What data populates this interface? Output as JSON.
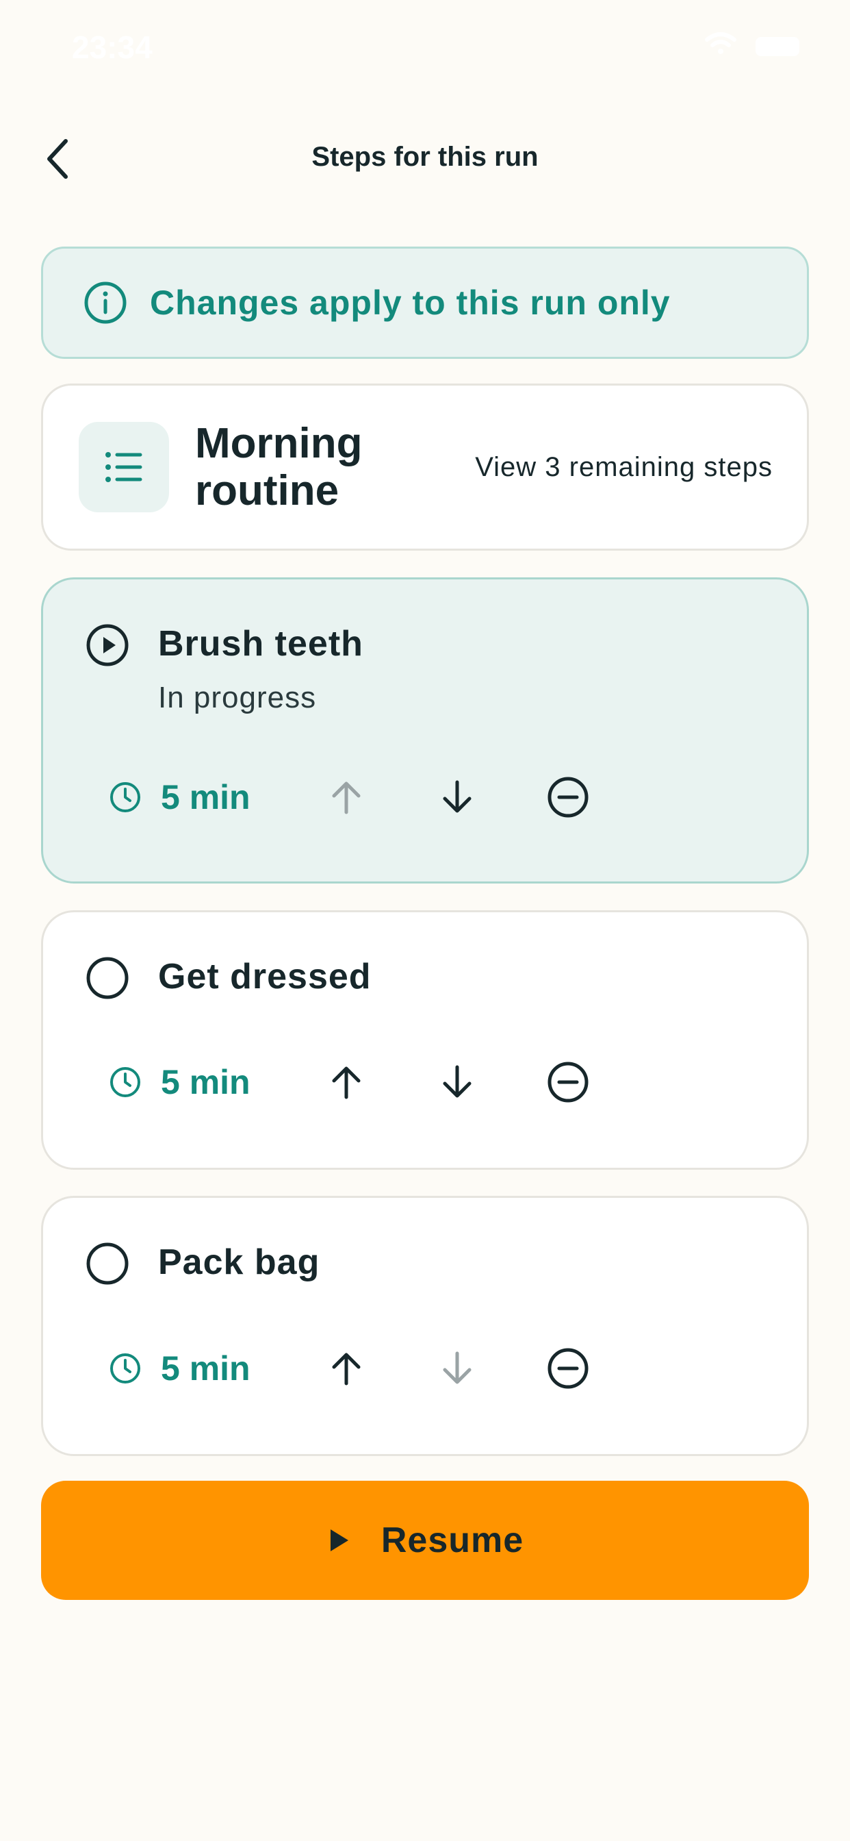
{
  "status_bar": {
    "time": "23:34"
  },
  "header": {
    "title": "Steps for this run",
    "back_icon": "chevron-left-icon"
  },
  "info_banner": {
    "text": "Changes apply to this run only",
    "icon": "info-icon",
    "color": "#138A7C"
  },
  "routine": {
    "name": "Morning routine",
    "link": "View 3 remaining steps",
    "icon": "list-icon"
  },
  "steps": [
    {
      "title": "Brush teeth",
      "subtitle": "In progress",
      "status_icon": "play-circle-icon",
      "duration": "5 min",
      "active": true,
      "move_up_enabled": false,
      "move_down_enabled": true
    },
    {
      "title": "Get dressed",
      "status_icon": "empty-circle-icon",
      "duration": "5 min",
      "active": false,
      "move_up_enabled": true,
      "move_down_enabled": true
    },
    {
      "title": "Pack bag",
      "status_icon": "empty-circle-icon",
      "duration": "5 min",
      "active": false,
      "move_up_enabled": true,
      "move_down_enabled": false
    }
  ],
  "resume": {
    "label": "Resume",
    "icon": "play-icon",
    "color": "#FF9400"
  },
  "colors": {
    "teal": "#138A7C",
    "background": "#FDFBF6",
    "active_card": "#E9F3F1",
    "disabled_icon": "#9AA3A5"
  }
}
